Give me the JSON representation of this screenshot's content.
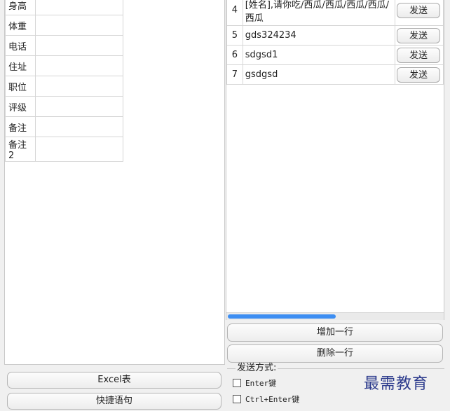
{
  "fields": [
    "身高",
    "体重",
    "电话",
    "住址",
    "职位",
    "评级",
    "备注",
    "备注2"
  ],
  "messages": [
    {
      "num": "4",
      "text": "[姓名],请你吃/西瓜/西瓜/西瓜/西瓜/西瓜",
      "action": "发送"
    },
    {
      "num": "5",
      "text": "gds324234",
      "action": "发送"
    },
    {
      "num": "6",
      "text": "sdgsd1",
      "action": "发送"
    },
    {
      "num": "7",
      "text": "gsdgsd",
      "action": "发送"
    }
  ],
  "buttons": {
    "add_row": "增加一行",
    "delete_row": "删除一行",
    "excel": "Excel表",
    "quick": "快捷语句"
  },
  "send_mode": {
    "title": "发送方式:",
    "opt_enter": "Enter键",
    "opt_ctrl_enter": "Ctrl+Enter键"
  },
  "watermark": "最需教育"
}
